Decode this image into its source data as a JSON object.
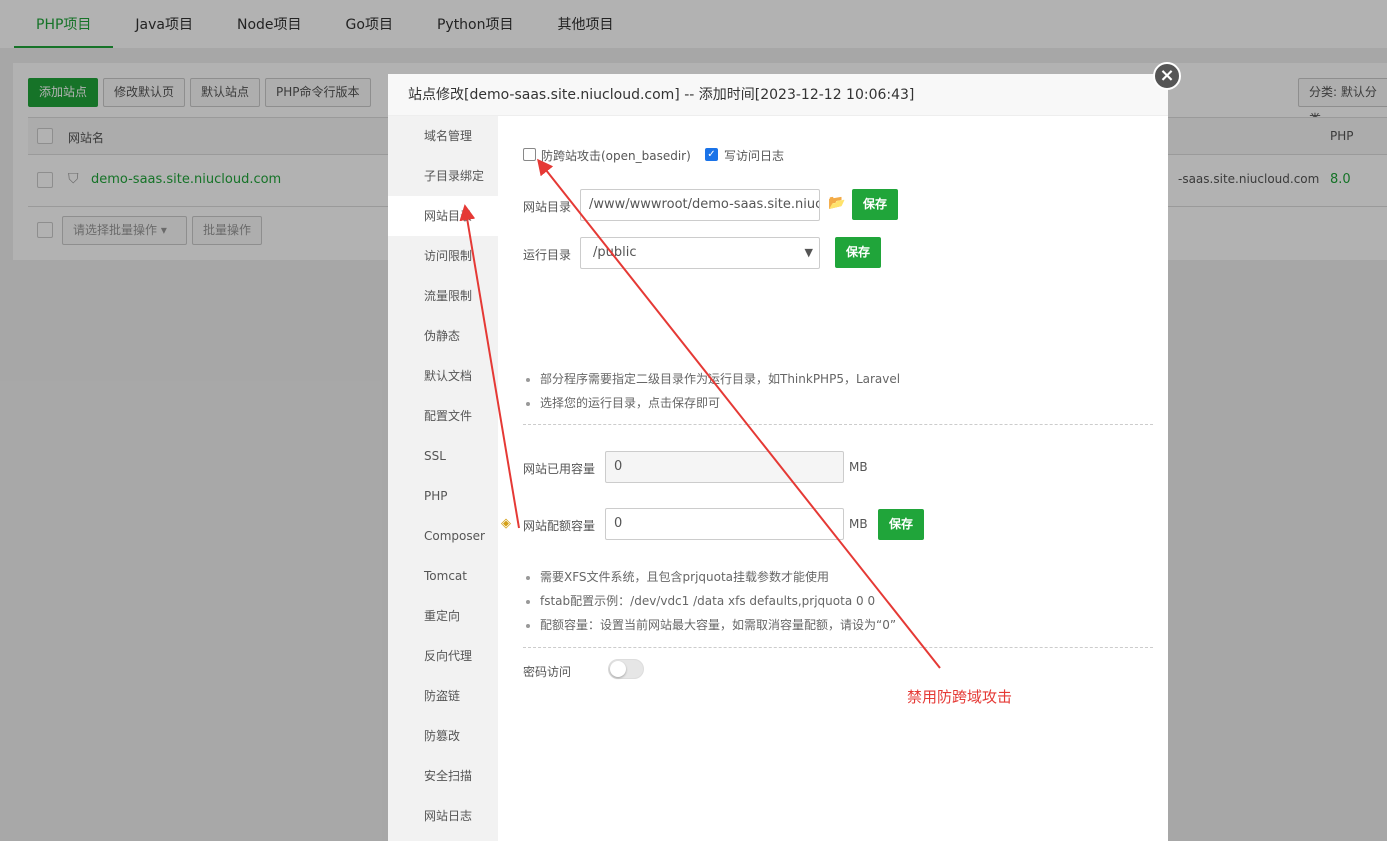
{
  "topnav": {
    "tabs": [
      "PHP项目",
      "Java项目",
      "Node项目",
      "Go项目",
      "Python项目",
      "其他项目"
    ],
    "active": 0
  },
  "toolbar": {
    "add_site": "添加站点",
    "edit_default_page": "修改默认页",
    "default_site": "默认站点",
    "php_cli_version": "PHP命令行版本",
    "category": "分类: 默认分类"
  },
  "table": {
    "headers": {
      "name": "网站名",
      "php": "PHP"
    },
    "rows": [
      {
        "name": "demo-saas.site.niucloud.com",
        "domain_partial": "-saas.site.niucloud.com",
        "php": "8.0"
      }
    ],
    "batch_placeholder": "请选择批量操作",
    "batch_button": "批量操作"
  },
  "modal": {
    "title": "站点修改[demo-saas.site.niucloud.com] -- 添加时间[2023-12-12 10:06:43]",
    "close_icon": "×",
    "sidebar": [
      "域名管理",
      "子目录绑定",
      "网站目录",
      "访问限制",
      "流量限制",
      "伪静态",
      "默认文档",
      "配置文件",
      "SSL",
      "PHP",
      "Composer",
      "Tomcat",
      "重定向",
      "反向代理",
      "防盗链",
      "防篡改",
      "安全扫描",
      "网站日志"
    ],
    "active_index": 2,
    "open_basedir": {
      "label": "防跨站攻击(open_basedir)",
      "checked": false
    },
    "access_log": {
      "label": "写访问日志",
      "checked": true
    },
    "site_dir": {
      "label": "网站目录",
      "value": "/www/wwwroot/demo-saas.site.niucloud.com",
      "save": "保存"
    },
    "run_dir": {
      "label": "运行目录",
      "value": "/public",
      "save": "保存"
    },
    "run_tips": [
      "部分程序需要指定二级目录作为运行目录，如ThinkPHP5，Laravel",
      "选择您的运行目录，点击保存即可"
    ],
    "used_quota": {
      "label": "网站已用容量",
      "value": "0",
      "unit": "MB"
    },
    "quota": {
      "label": "网站配额容量",
      "value": "0",
      "unit": "MB",
      "save": "保存"
    },
    "quota_tips": [
      "需要XFS文件系统，且包含prjquota挂载参数才能使用",
      "fstab配置示例：/dev/vdc1 /data xfs defaults,prjquota 0 0",
      "配额容量：设置当前网站最大容量，如需取消容量配额，请设为“0”"
    ],
    "password_access": {
      "label": "密码访问",
      "enabled": false
    }
  },
  "annotation": {
    "text": "禁用防跨域攻击",
    "color": "#e53935"
  }
}
